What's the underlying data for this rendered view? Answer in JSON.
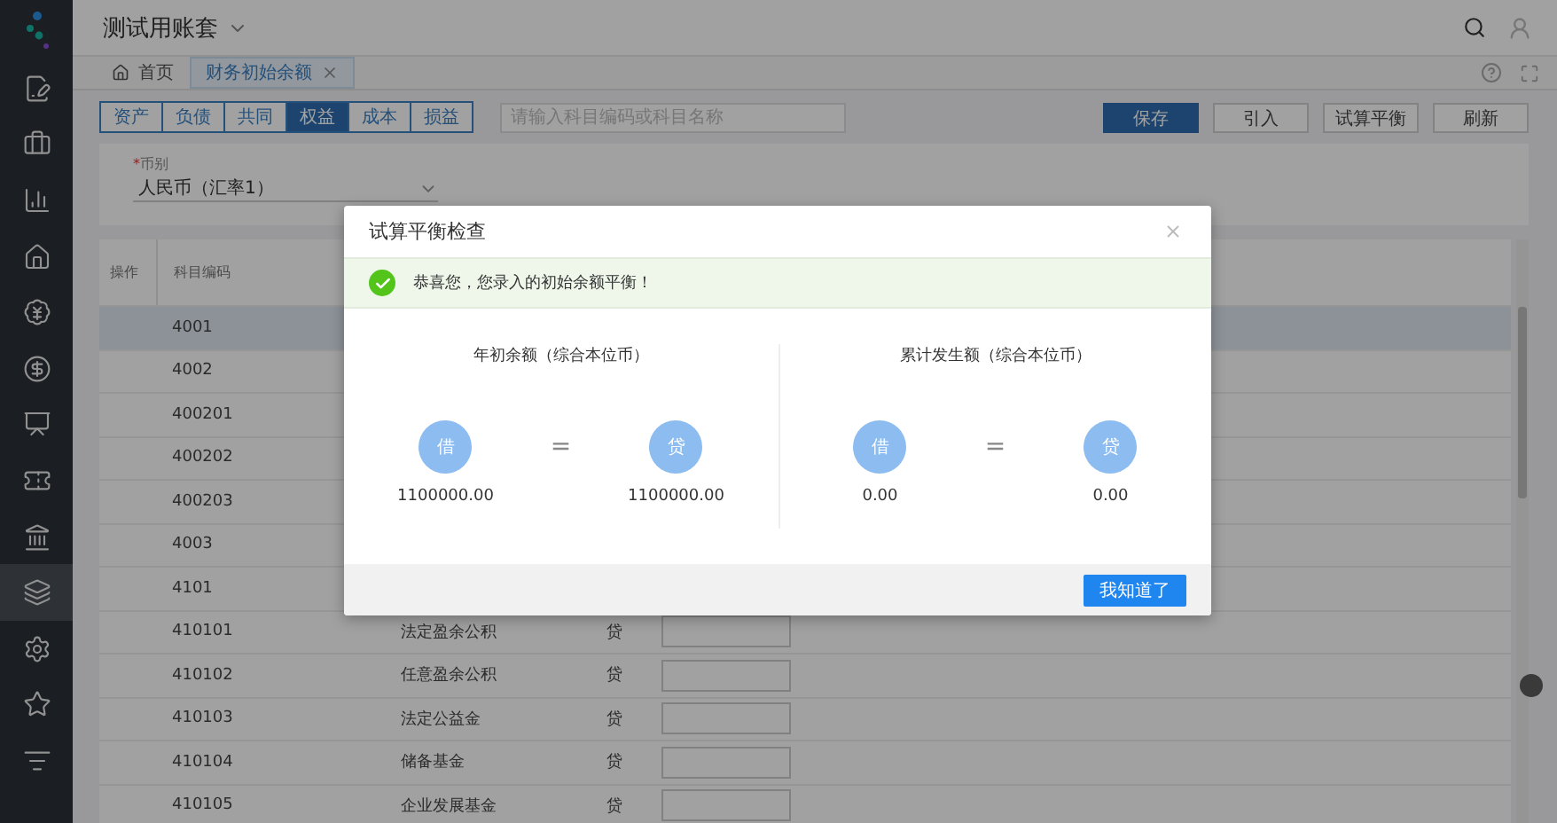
{
  "sidebar": {
    "items": [
      {
        "selected": false
      },
      {
        "selected": false
      },
      {
        "selected": false
      },
      {
        "selected": false
      },
      {
        "selected": false
      },
      {
        "selected": false
      },
      {
        "selected": false
      },
      {
        "selected": false
      },
      {
        "selected": false
      },
      {
        "selected": true
      },
      {
        "selected": false
      },
      {
        "selected": false
      },
      {
        "selected": false
      }
    ]
  },
  "header": {
    "title": "测试用账套"
  },
  "tabs": [
    {
      "label": "首页",
      "kind": "home",
      "selected": false
    },
    {
      "label": "财务初始余额",
      "kind": "closable",
      "selected": true
    }
  ],
  "categories": [
    {
      "label": "资产",
      "selected": false
    },
    {
      "label": "负债",
      "selected": false
    },
    {
      "label": "共同",
      "selected": false
    },
    {
      "label": "权益",
      "selected": true
    },
    {
      "label": "成本",
      "selected": false
    },
    {
      "label": "损益",
      "selected": false
    }
  ],
  "search": {
    "placeholder": "请输入科目编码或科目名称"
  },
  "actions": [
    {
      "label": "保存",
      "kind": "primary"
    },
    {
      "label": "引入",
      "kind": "default"
    },
    {
      "label": "试算平衡",
      "kind": "default"
    },
    {
      "label": "刷新",
      "kind": "default"
    }
  ],
  "filter": {
    "required_mark": "*",
    "label": "币别",
    "value": "人民币（汇率1）"
  },
  "table": {
    "columns": [
      "操作",
      "科目编码"
    ],
    "rows": [
      {
        "code": "4001",
        "selected": true
      },
      {
        "code": "4002",
        "selected": false
      },
      {
        "code": "400201",
        "selected": false
      },
      {
        "code": "400202",
        "selected": false
      },
      {
        "code": "400203",
        "selected": false
      },
      {
        "code": "4003",
        "selected": false
      },
      {
        "code": "4101",
        "selected": false
      },
      {
        "code": "410101",
        "name": "法定盈余公积",
        "direction": "贷",
        "selected": false
      },
      {
        "code": "410102",
        "name": "任意盈余公积",
        "direction": "贷",
        "selected": false
      },
      {
        "code": "410103",
        "name": "法定公益金",
        "direction": "贷",
        "selected": false
      },
      {
        "code": "410104",
        "name": "储备基金",
        "direction": "贷",
        "selected": false
      },
      {
        "code": "410105",
        "name": "企业发展基金",
        "direction": "贷",
        "selected": false
      }
    ]
  },
  "dialog": {
    "title": "试算平衡检查",
    "message": "恭喜您，您录入的初始余额平衡！",
    "panels": [
      {
        "title": "年初余额（综合本位币）",
        "debit_label": "借",
        "equals": "=",
        "credit_label": "贷",
        "debit": "1100000.00",
        "credit": "1100000.00"
      },
      {
        "title": "累计发生额（综合本位币）",
        "debit_label": "借",
        "equals": "=",
        "credit_label": "贷",
        "debit": "0.00",
        "credit": "0.00"
      }
    ],
    "button": "我知道了"
  }
}
